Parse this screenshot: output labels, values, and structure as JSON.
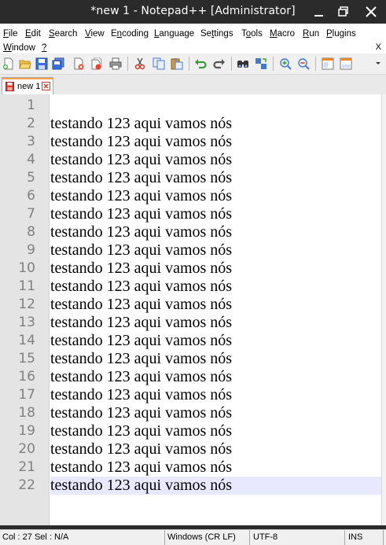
{
  "window": {
    "title": "*new 1 - Notepad++ [Administrator]",
    "buttons": [
      "minimize",
      "maximize",
      "close"
    ]
  },
  "menu": {
    "items": [
      {
        "label": "File",
        "underline": "F"
      },
      {
        "label": "Edit",
        "underline": "E"
      },
      {
        "label": "Search",
        "underline": "S"
      },
      {
        "label": "View",
        "underline": "V"
      },
      {
        "label": "Encoding",
        "underline": "n"
      },
      {
        "label": "Language",
        "underline": "L"
      },
      {
        "label": "Settings",
        "underline": "t"
      },
      {
        "label": "Tools",
        "underline": "o"
      },
      {
        "label": "Macro",
        "underline": "M"
      },
      {
        "label": "Run",
        "underline": "R"
      },
      {
        "label": "Plugins",
        "underline": "P"
      },
      {
        "label": "Window",
        "underline": "W"
      },
      {
        "label": "?",
        "underline": "?"
      }
    ],
    "close_doc": "X"
  },
  "toolbar": {
    "icons": [
      "new-file-icon",
      "open-file-icon",
      "save-icon",
      "save-all-icon",
      "close-icon",
      "close-all-icon",
      "print-icon",
      "cut-icon",
      "copy-icon",
      "paste-icon",
      "undo-icon",
      "redo-icon",
      "find-icon",
      "replace-icon",
      "zoom-in-icon",
      "zoom-out-icon",
      "sync-vertical-icon",
      "sync-horizontal-icon"
    ]
  },
  "tabs": [
    {
      "label": "new 1",
      "modified": true
    }
  ],
  "editor": {
    "current_line": 22,
    "lines": [
      "",
      "testando 123 aqui vamos nós",
      "testando 123 aqui vamos nós",
      "testando 123 aqui vamos nós",
      "testando 123 aqui vamos nós",
      "testando 123 aqui vamos nós",
      "testando 123 aqui vamos nós",
      "testando 123 aqui vamos nós",
      "testando 123 aqui vamos nós",
      "testando 123 aqui vamos nós",
      "testando 123 aqui vamos nós",
      "testando 123 aqui vamos nós",
      "testando 123 aqui vamos nós",
      "testando 123 aqui vamos nós",
      "testando 123 aqui vamos nós",
      "testando 123 aqui vamos nós",
      "testando 123 aqui vamos nós",
      "testando 123 aqui vamos nós",
      "testando 123 aqui vamos nós",
      "testando 123 aqui vamos nós",
      "testando 123 aqui vamos nós",
      "testando 123 aqui vamos nós"
    ]
  },
  "status": {
    "position": "Col : 27    Sel : N/A",
    "eol": "Windows (CR LF)",
    "encoding": "UTF-8",
    "mode": "INS"
  },
  "colors": {
    "title_bg": "#2b2b2b",
    "current_line_bg": "#e8e8ff",
    "gutter_bg": "#e4e4e4",
    "line_number": "#808080",
    "tab_accent": "#f6a64a"
  }
}
